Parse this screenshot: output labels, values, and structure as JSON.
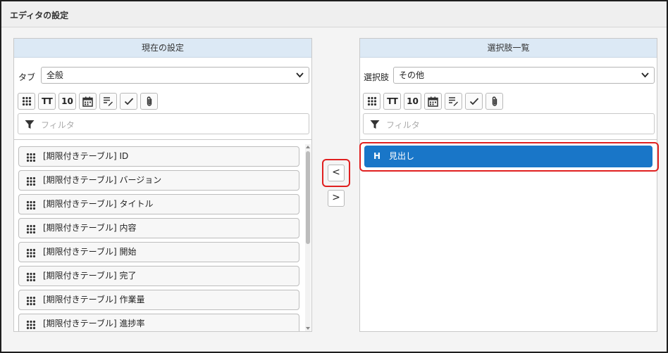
{
  "dialog": {
    "title": "エディタの設定"
  },
  "left_panel": {
    "title": "現在の設定",
    "tab_label": "タブ",
    "tab_value": "全般",
    "filter_placeholder": "フィルタ",
    "items": [
      "[期限付きテーブル] ID",
      "[期限付きテーブル] バージョン",
      "[期限付きテーブル] タイトル",
      "[期限付きテーブル] 内容",
      "[期限付きテーブル] 開始",
      "[期限付きテーブル] 完了",
      "[期限付きテーブル] 作業量",
      "[期限付きテーブル] 進捗率"
    ]
  },
  "right_panel": {
    "title": "選択肢一覧",
    "choice_label": "選択肢",
    "choice_value": "その他",
    "filter_placeholder": "フィルタ",
    "items": [
      {
        "letter": "H",
        "label": "見出し"
      }
    ]
  },
  "toolbar": {
    "icons": [
      "grip-icon",
      "text-size-icon",
      "number-icon",
      "calendar-icon",
      "text-edit-icon",
      "check-icon",
      "attachment-icon"
    ],
    "text_size_glyph": "TT",
    "number_glyph": "10"
  },
  "move_buttons": {
    "left_glyph": "<",
    "right_glyph": ">"
  },
  "colors": {
    "header_blue": "#dce9f5",
    "selected_blue": "#1976c8",
    "highlight_red": "#e02020"
  }
}
